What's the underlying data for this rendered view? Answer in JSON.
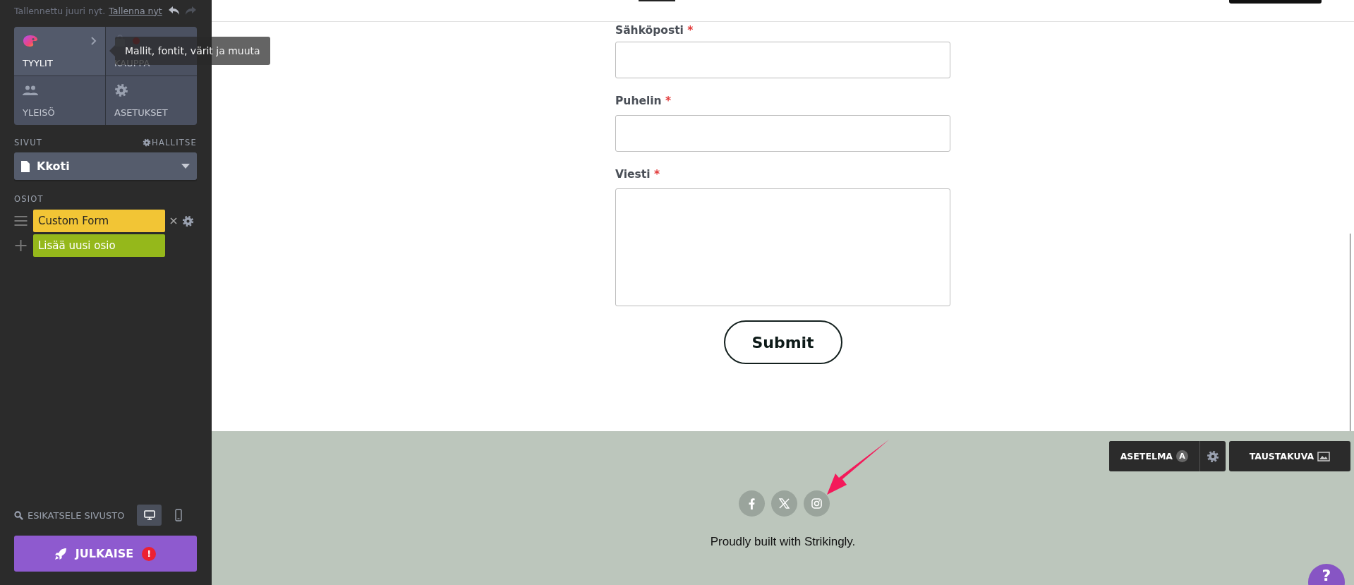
{
  "save_status": {
    "text": "Tallennettu juuri nyt.",
    "link": "Tallenna nyt",
    "undo_enabled": true,
    "redo_enabled": false
  },
  "tiles": [
    {
      "label": "TYYLIT",
      "kind": "styles",
      "selected": true,
      "notification": false
    },
    {
      "label": "KAUPPA",
      "kind": "store",
      "selected": false,
      "notification": true
    },
    {
      "label": "YLEISÖ",
      "kind": "audience",
      "selected": false,
      "notification": false
    },
    {
      "label": "ASETUKSET",
      "kind": "settings",
      "selected": false,
      "notification": false
    }
  ],
  "tooltip": "Mallit, fontit, värit ja muuta",
  "pages": {
    "label": "SIVUT",
    "manage": "HALLITSE",
    "current": "Kkoti"
  },
  "sections": {
    "label": "OSIOT",
    "items": [
      {
        "name": "Custom Form",
        "kind": "section",
        "color": "#f2c535"
      },
      {
        "name": "Lisää uusi osio",
        "kind": "add",
        "color": "#95b81b"
      }
    ]
  },
  "preview": {
    "label": "ESIKATSELE SIVUSTO",
    "devices": [
      {
        "kind": "desktop",
        "selected": true
      },
      {
        "kind": "mobile",
        "selected": false
      }
    ]
  },
  "publish": {
    "label": "JULKAISE",
    "warning": "!"
  },
  "form": {
    "required_mark": "*",
    "fields": [
      {
        "label": "Sähköposti",
        "kind": "input",
        "required": true
      },
      {
        "label": "Puhelin",
        "kind": "input",
        "required": true
      },
      {
        "label": "Viesti",
        "kind": "textarea",
        "required": true
      }
    ],
    "submit": "Submit"
  },
  "footer": {
    "layout_button": {
      "label": "ASETELMA",
      "badge": "A"
    },
    "background_button": "TAUSTAKUVA",
    "social": [
      {
        "kind": "facebook"
      },
      {
        "kind": "x"
      },
      {
        "kind": "instagram"
      }
    ],
    "credit": "Proudly built with Strikingly.",
    "help": "?"
  }
}
